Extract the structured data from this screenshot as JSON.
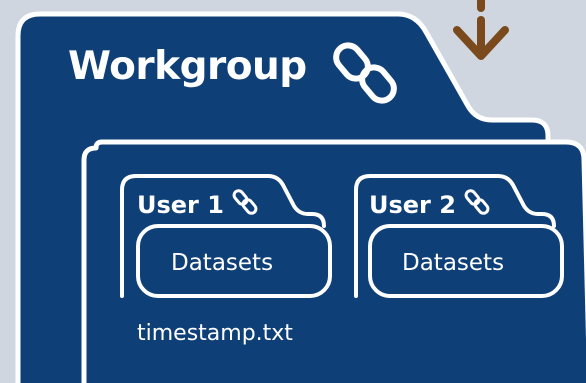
{
  "colors": {
    "background": "#cfd6e0",
    "folder_fill": "#0f3f77",
    "outline": "#ffffff",
    "arrow": "#7a4a1c"
  },
  "icons": [
    "link-icon",
    "download-arrow-icon"
  ],
  "workgroup": {
    "title": "Workgroup"
  },
  "users": [
    {
      "title": "User 1",
      "datasets_label": "Datasets"
    },
    {
      "title": "User 2",
      "datasets_label": "Datasets"
    }
  ],
  "file": {
    "name": "timestamp.txt"
  }
}
